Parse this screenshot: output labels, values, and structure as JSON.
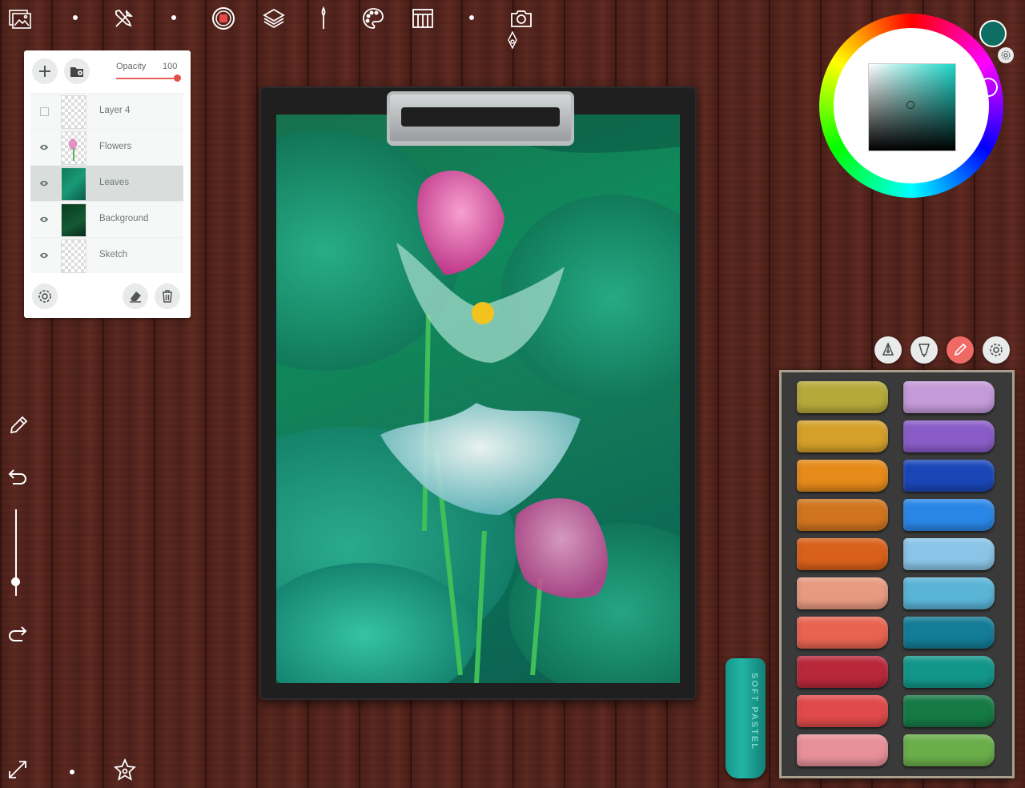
{
  "toolbar": {
    "items": [
      "gallery-icon",
      "tools-icon",
      "record-icon",
      "layers-icon",
      "brush-icon",
      "palette-icon",
      "reference-icon",
      "camera-icon"
    ]
  },
  "layers_panel": {
    "opacity_label": "Opacity",
    "opacity_value": "100",
    "opacity_fraction": 1.0,
    "layers": [
      {
        "name": "Layer 4",
        "visible": false,
        "active": false
      },
      {
        "name": "Flowers",
        "visible": true,
        "active": false
      },
      {
        "name": "Leaves",
        "visible": true,
        "active": true
      },
      {
        "name": "Background",
        "visible": true,
        "active": false
      },
      {
        "name": "Sketch",
        "visible": true,
        "active": false
      }
    ]
  },
  "color_picker": {
    "current_color": "#0e6e62",
    "hue_color": "#1dd6c8"
  },
  "brush_modes": [
    "pen-nib-icon",
    "fill-nib-icon",
    "eyedropper-icon",
    "settings-icon"
  ],
  "pastel_box": {
    "left_column": [
      "#b5a93a",
      "#d4a02a",
      "#e68a1a",
      "#d0741e",
      "#d8601a",
      "#e89a80",
      "#e86450",
      "#b8283a",
      "#e04a4a",
      "#e8909a"
    ],
    "right_column": [
      "#c49ad8",
      "#8a5cc8",
      "#1a46b8",
      "#2a86e6",
      "#8ac4e6",
      "#5ab4d6",
      "#137c96",
      "#13968a",
      "#157a45",
      "#6aae4a"
    ]
  },
  "loose_pastel": {
    "label": "SOFT PASTEL"
  },
  "side_tools": [
    "eyedropper-icon",
    "undo-icon",
    "brush-size-slider",
    "redo-icon"
  ],
  "brush_size_fraction": 0.2
}
